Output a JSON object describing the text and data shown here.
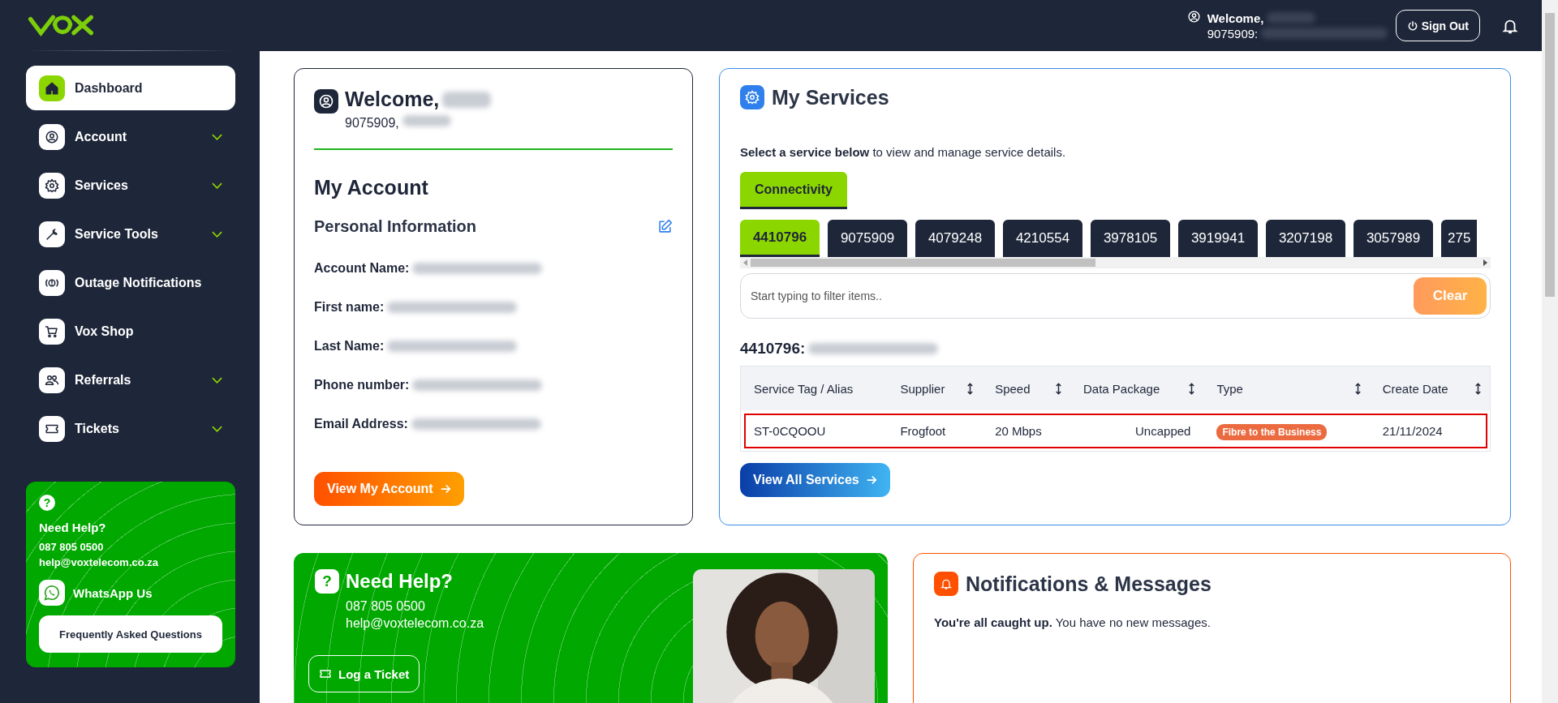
{
  "header": {
    "welcome": "Welcome,",
    "account": "9075909:",
    "sign_out": "Sign Out"
  },
  "sidebar": {
    "items": [
      {
        "label": "Dashboard",
        "kind": "home",
        "selected": true,
        "expandable": false
      },
      {
        "label": "Account",
        "kind": "user",
        "selected": false,
        "expandable": true
      },
      {
        "label": "Services",
        "kind": "gear",
        "selected": false,
        "expandable": true
      },
      {
        "label": "Service Tools",
        "kind": "wrench",
        "selected": false,
        "expandable": true
      },
      {
        "label": "Outage Notifications",
        "kind": "alert",
        "selected": false,
        "expandable": false
      },
      {
        "label": "Vox Shop",
        "kind": "cart",
        "selected": false,
        "expandable": false
      },
      {
        "label": "Referrals",
        "kind": "people",
        "selected": false,
        "expandable": true
      },
      {
        "label": "Tickets",
        "kind": "ticket",
        "selected": false,
        "expandable": true
      }
    ],
    "help": {
      "icon_text": "?",
      "title": "Need Help?",
      "phone": "087 805 0500",
      "email": "help@voxtelecom.co.za",
      "whatsapp": "WhatsApp Us",
      "faq": "Frequently Asked Questions"
    }
  },
  "welcome_card": {
    "title": "Welcome,",
    "account": "9075909,",
    "heading": "My Account",
    "subheading": "Personal Information",
    "fields": [
      {
        "label": "Account Name:"
      },
      {
        "label": "First name:"
      },
      {
        "label": "Last Name:"
      },
      {
        "label": "Phone number:"
      },
      {
        "label": "Email Address:"
      }
    ],
    "button": "View My Account"
  },
  "services_card": {
    "title": "My Services",
    "intro": "**Select a service below** to view and manage service details.",
    "categories": [
      {
        "label": "Connectivity",
        "selected": true
      }
    ],
    "accounts": [
      {
        "label": "4410796",
        "selected": true
      },
      {
        "label": "9075909",
        "selected": false
      },
      {
        "label": "4079248",
        "selected": false
      },
      {
        "label": "4210554",
        "selected": false
      },
      {
        "label": "3978105",
        "selected": false
      },
      {
        "label": "3919941",
        "selected": false
      },
      {
        "label": "3207198",
        "selected": false
      },
      {
        "label": "3057989",
        "selected": false
      },
      {
        "label": "275",
        "selected": false
      }
    ],
    "filter": {
      "placeholder": "Start typing to filter items.."
    },
    "clear": "Clear",
    "account_heading": "4410796:",
    "table": {
      "columns": [
        {
          "label": "Service Tag / Alias",
          "sortable": false
        },
        {
          "label": "Supplier",
          "sortable": true
        },
        {
          "label": "Speed",
          "sortable": true
        },
        {
          "label": "Data Package",
          "sortable": true
        },
        {
          "label": "Type",
          "sortable": true
        },
        {
          "label": "Create Date",
          "sortable": true
        }
      ],
      "rows": [
        {
          "tag": "ST-0CQOOU",
          "supplier": "Frogfoot",
          "speed": "20 Mbps",
          "package": "Uncapped",
          "type": "Fibre to the Business",
          "date": "21/11/2024",
          "highlighted": true
        }
      ]
    },
    "button": "View All Services"
  },
  "help_panel": {
    "icon_text": "?",
    "title": "Need Help?",
    "phone": "087 805 0500",
    "email": "help@voxtelecom.co.za",
    "button": "Log a Ticket"
  },
  "notifications": {
    "title": "Notifications & Messages",
    "message": "**You're all caught up.** You have no new messages."
  }
}
